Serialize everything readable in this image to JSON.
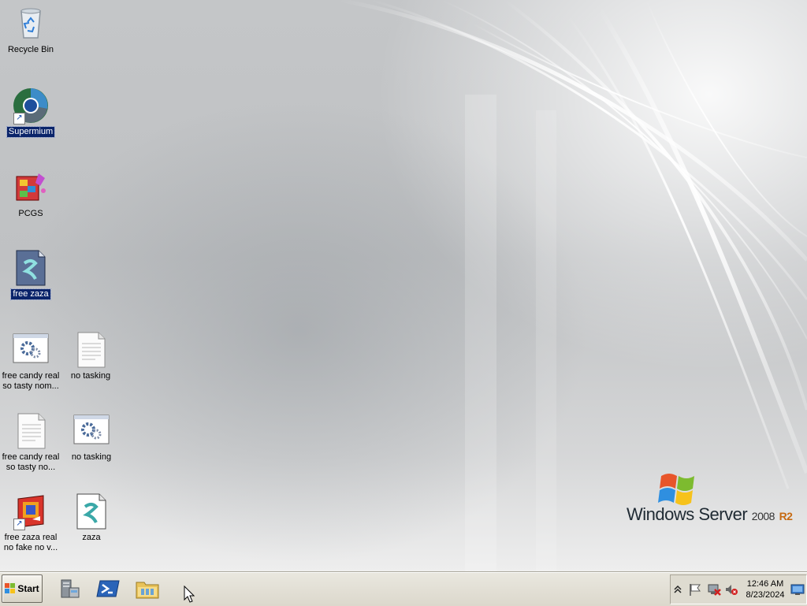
{
  "desktop": {
    "icons": [
      {
        "label": "Recycle Bin",
        "icon": "recycle-bin-icon",
        "selected": false
      },
      {
        "label": "Supermium",
        "icon": "supermium-browser-icon",
        "shortcut": true,
        "selected": true
      },
      {
        "label": "PCGS",
        "icon": "pcgs-app-icon",
        "selected": false
      },
      {
        "label": "free zaza",
        "icon": "script-file-icon",
        "selected": true
      },
      {
        "label": "free candy real\nso tasty nom...",
        "icon": "settings-file-icon",
        "selected": false
      },
      {
        "label": "no tasking",
        "icon": "text-document-icon",
        "selected": false
      },
      {
        "label": "free candy real\nso tasty no...",
        "icon": "text-document-icon",
        "selected": false
      },
      {
        "label": "no tasking",
        "icon": "settings-file-icon",
        "selected": false
      },
      {
        "label": "free zaza real\nno fake no v...",
        "icon": "installer-app-icon",
        "shortcut": true,
        "selected": false
      },
      {
        "label": "zaza",
        "icon": "script-file-icon",
        "selected": false
      }
    ],
    "branding": {
      "product": "Windows Server",
      "version": "2008",
      "edition": "R2"
    }
  },
  "taskbar": {
    "start_label": "Start",
    "quick_launch": [
      "server-manager-icon",
      "powershell-icon",
      "windows-explorer-icon"
    ],
    "tray": {
      "icons": [
        "show-hidden-icons-chevron",
        "action-center-flag-icon",
        "network-disconnected-icon",
        "volume-muted-icon",
        "show-desktop-icon"
      ],
      "time": "12:46 AM",
      "date": "8/23/2024"
    }
  },
  "colors": {
    "selection": "#0a246a",
    "taskbar": "#dcd8cc",
    "brand_r2": "#c66a12"
  }
}
